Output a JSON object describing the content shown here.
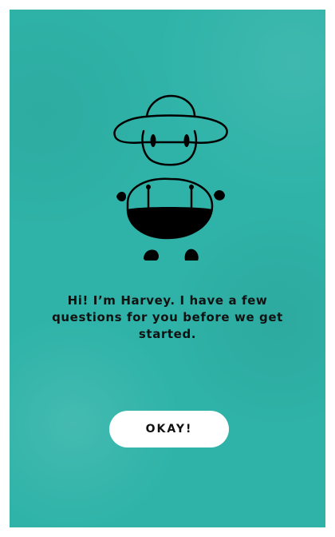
{
  "onboarding": {
    "intro_message": "Hi! I’m Harvey. I have a few questions for you before we get started.",
    "okay_button_label": "OKAY!",
    "mascot_icon": "harvey-farmer-mascot-icon"
  },
  "colors": {
    "background": "#2fb3a8",
    "button_background": "#ffffff",
    "text": "#111111"
  }
}
